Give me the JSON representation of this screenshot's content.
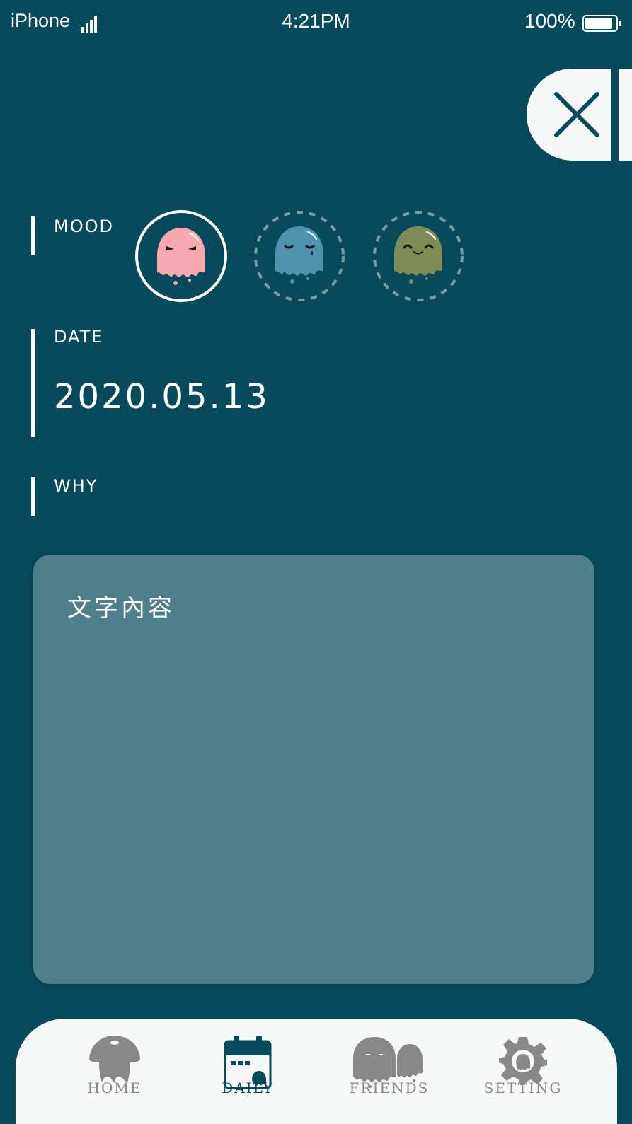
{
  "status_bar": {
    "carrier": "iPhone",
    "time": "4:21PM",
    "battery": "100%"
  },
  "form": {
    "mood": {
      "label": "MOOD",
      "options": [
        {
          "name": "angry",
          "color": "#f7a8b0",
          "selected": true
        },
        {
          "name": "sad",
          "color": "#4e93ad",
          "selected": false
        },
        {
          "name": "happy",
          "color": "#7e8b55",
          "selected": false
        }
      ]
    },
    "date": {
      "label": "DATE",
      "value": "2020.05.13"
    },
    "why": {
      "label": "WHY",
      "text": "文字內容"
    }
  },
  "tabs": [
    {
      "label": "HOME",
      "icon": "mushroom-icon",
      "active": false
    },
    {
      "label": "DAILY",
      "icon": "calendar-icon",
      "active": true
    },
    {
      "label": "FRIENDS",
      "icon": "ghosts-icon",
      "active": false
    },
    {
      "label": "SETTING",
      "icon": "gear-icon",
      "active": false
    }
  ],
  "colors": {
    "background": "#064a5c",
    "panel": "#4f7f8c",
    "tabbar": "#f6f7f7",
    "inactive": "#888888"
  }
}
